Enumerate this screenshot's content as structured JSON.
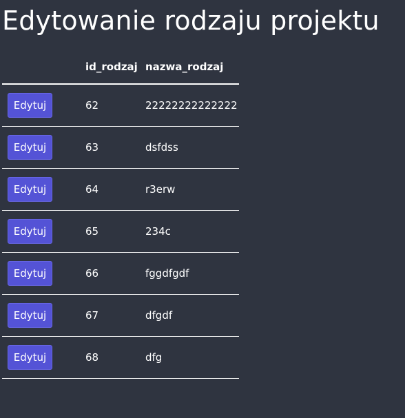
{
  "page": {
    "title": "Edytowanie rodzaju projektu"
  },
  "table": {
    "columns": [
      "",
      "id_rodzaj",
      "nazwa_rodzaj"
    ],
    "edit_label": "Edytuj",
    "rows": [
      {
        "id": "62",
        "name": "22222222222222"
      },
      {
        "id": "63",
        "name": "dsfdss"
      },
      {
        "id": "64",
        "name": "r3erw"
      },
      {
        "id": "65",
        "name": "234c"
      },
      {
        "id": "66",
        "name": "fggdfgdf"
      },
      {
        "id": "67",
        "name": "dfgdf"
      },
      {
        "id": "68",
        "name": "dfg"
      }
    ]
  },
  "colors": {
    "background": "#2f3440",
    "button": "#5453d6",
    "text": "#ffffff"
  }
}
